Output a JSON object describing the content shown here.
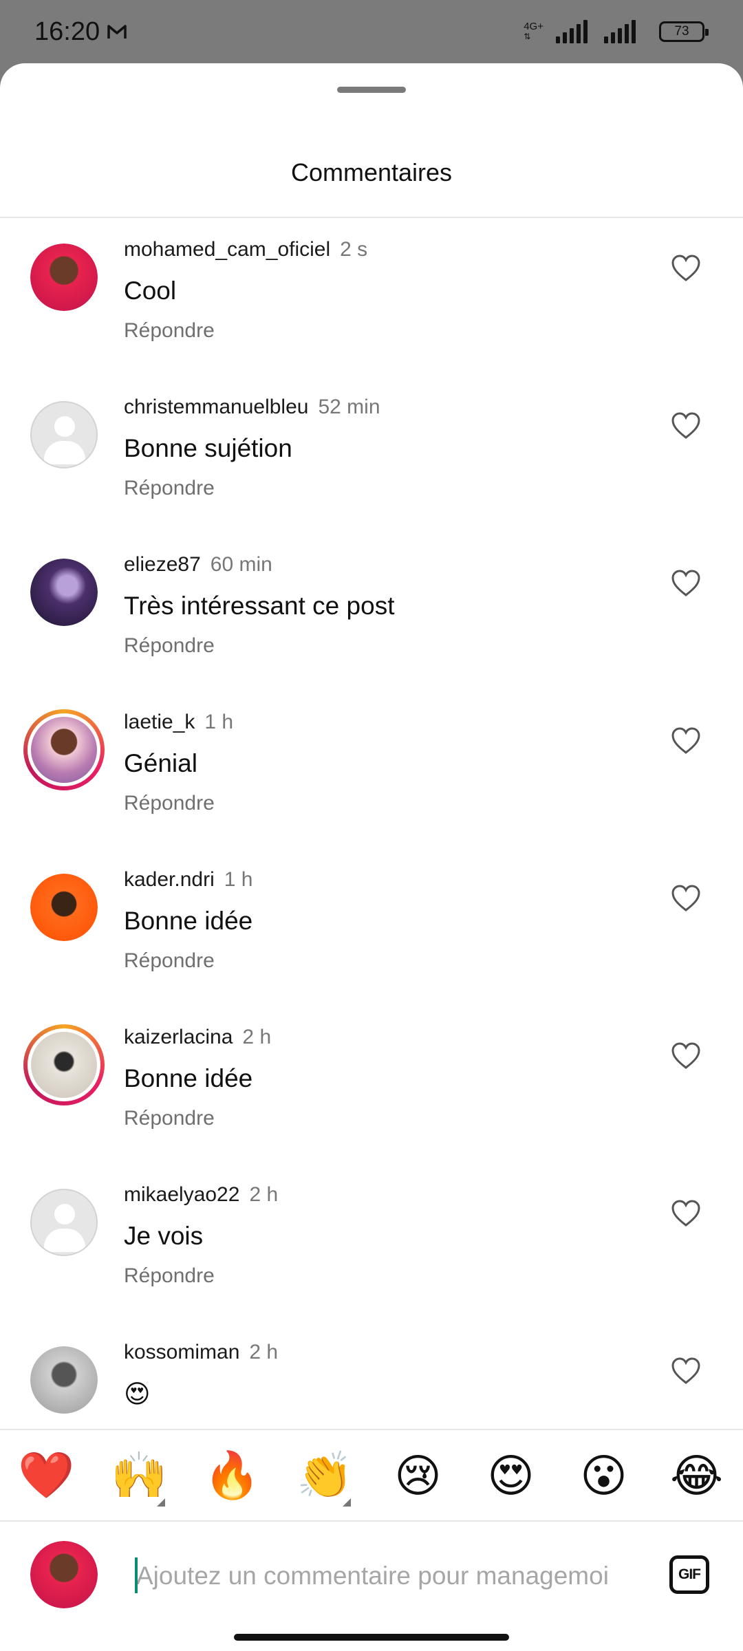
{
  "status_bar": {
    "time": "16:20",
    "network": "4G+",
    "battery": "73"
  },
  "sheet": {
    "title": "Commentaires"
  },
  "comments": [
    {
      "username": "mohamed_cam_oficiel",
      "time": "2 s",
      "text": "Cool",
      "reply": "Répondre"
    },
    {
      "username": "christemmanuelbleu",
      "time": "52 min",
      "text": "Bonne sujétion",
      "reply": "Répondre"
    },
    {
      "username": "elieze87",
      "time": "60 min",
      "text": "Très intéressant ce post",
      "reply": "Répondre"
    },
    {
      "username": "laetie_k",
      "time": "1 h",
      "text": "Génial",
      "reply": "Répondre"
    },
    {
      "username": "kader.ndri",
      "time": "1 h",
      "text": "Bonne idée",
      "reply": "Répondre"
    },
    {
      "username": "kaizerlacina",
      "time": "2 h",
      "text": "Bonne idée",
      "reply": "Répondre"
    },
    {
      "username": "mikaelyao22",
      "time": "2 h",
      "text": "Je vois",
      "reply": "Répondre"
    },
    {
      "username": "kossomiman",
      "time": "2 h",
      "text": "😍",
      "reply": ""
    }
  ],
  "emoji_bar": [
    "❤️",
    "🙌",
    "🔥",
    "👏",
    "😢",
    "😍",
    "😮",
    "😂"
  ],
  "composer": {
    "placeholder": "Ajoutez un commentaire pour managemoi",
    "gif_label": "GIF"
  },
  "colors": {
    "background_dim": "#7b7b7b",
    "sheet": "#ffffff",
    "story_ring_start": "#f5a623",
    "story_ring_end": "#e91e63",
    "cursor": "#0d8b6e"
  }
}
